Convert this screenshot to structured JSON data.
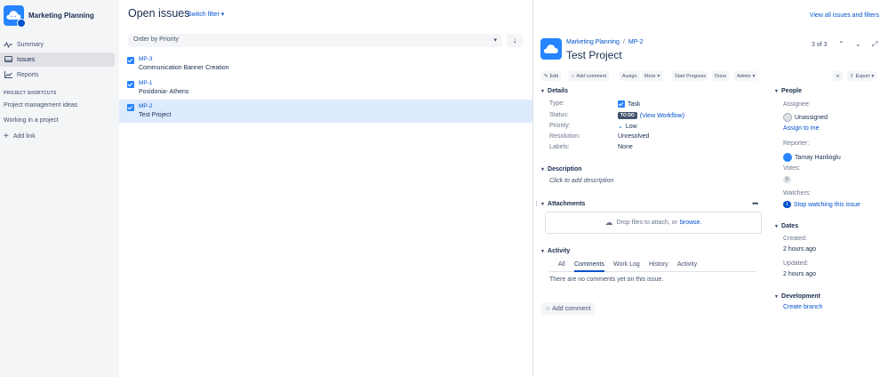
{
  "project": {
    "name": "Marketing Planning"
  },
  "sidebar": {
    "items": [
      {
        "label": "Summary",
        "icon": "summary-icon"
      },
      {
        "label": "Issues",
        "icon": "issues-icon",
        "active": true
      },
      {
        "label": "Reports",
        "icon": "reports-icon"
      }
    ],
    "shortcuts_title": "PROJECT SHORTCUTS",
    "shortcuts": [
      "Project management ideas",
      "Working in a project"
    ],
    "add_link": "Add link"
  },
  "list": {
    "title": "Open issues",
    "switch_filter": "Switch filter",
    "order_by": "Order by Priority",
    "issues": [
      {
        "key": "MP-3",
        "summary": "Communication Banner Creation"
      },
      {
        "key": "MP-1",
        "summary": "Posidonia- Athens"
      },
      {
        "key": "MP-2",
        "summary": "Test Project"
      }
    ]
  },
  "header": {
    "view_all": "View all issues and filters"
  },
  "detail": {
    "breadcrumb_project": "Marketing Planning",
    "breadcrumb_sep": "/",
    "breadcrumb_issue": "MP-2",
    "title": "Test Project",
    "pager": "3 of 3",
    "toolbar": {
      "edit": "Edit",
      "add_comment": "Add comment",
      "assign": "Assign",
      "more": "More",
      "start_progress": "Start Progress",
      "done": "Done",
      "admin": "Admin",
      "export": "Export"
    },
    "details": {
      "heading": "Details",
      "type_label": "Type:",
      "type_value": "Task",
      "status_label": "Status:",
      "status_value": "TO DO",
      "status_link": "(View Workflow)",
      "priority_label": "Priority:",
      "priority_value": "Low",
      "resolution_label": "Resolution:",
      "resolution_value": "Unresolved",
      "labels_label": "Labels:",
      "labels_value": "None"
    },
    "description": {
      "heading": "Description",
      "placeholder": "Click to add description"
    },
    "attachments": {
      "heading": "Attachments",
      "drop_text": "Drop files to attach, or",
      "browse": "browse."
    },
    "activity": {
      "heading": "Activity",
      "tabs": [
        "All",
        "Comments",
        "Work Log",
        "History",
        "Activity"
      ],
      "active_tab": "Comments",
      "empty": "There are no comments yet on this issue.",
      "add_comment": "Add comment"
    },
    "people": {
      "heading": "People",
      "assignee_label": "Assignee:",
      "assignee_value": "Unassigned",
      "assign_to_me": "Assign to me",
      "reporter_label": "Reporter:",
      "reporter_value": "Tamay Hanlioglu",
      "votes_label": "Votes:",
      "votes_value": "0",
      "watchers_label": "Watchers:",
      "watchers_count": "1",
      "watchers_link": "Stop watching this issue"
    },
    "dates": {
      "heading": "Dates",
      "created_label": "Created:",
      "created_value": "2 hours ago",
      "updated_label": "Updated:",
      "updated_value": "2 hours ago"
    },
    "development": {
      "heading": "Development",
      "create_branch": "Create branch"
    }
  },
  "colors": {
    "accent": "#0052cc",
    "sidebar_bg": "#f4f5f7",
    "selected_row": "#deebff",
    "avatar": "#2684ff"
  }
}
